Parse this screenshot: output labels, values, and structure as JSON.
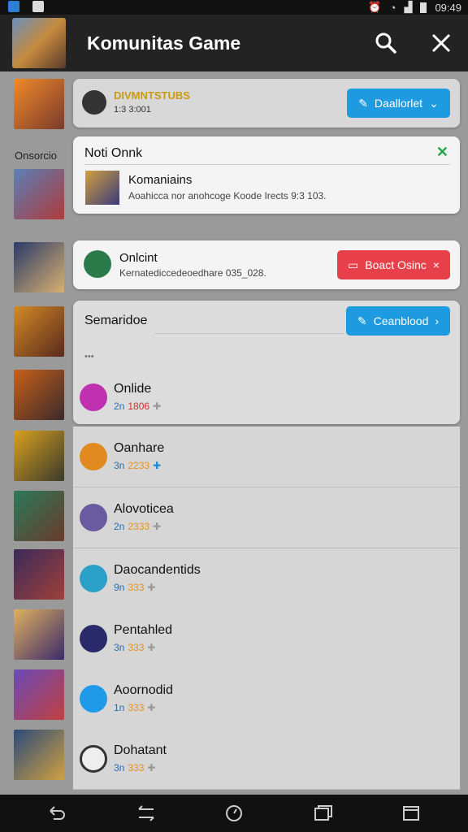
{
  "status_bar": {
    "time": "09:49"
  },
  "app_bar": {
    "title": "Komunitas Game"
  },
  "side_label": "Onsorcio",
  "top_card": {
    "title": "DIVMNTSTUBS",
    "subtitle": "1:3 3:001",
    "button_label": "Daallorlet"
  },
  "notif_card": {
    "header": "Noti Onnk",
    "item_title": "Komaniains",
    "item_text": "Aoahicca nor anohcoge Koode Irects 9:3 103."
  },
  "online_card": {
    "title": "Onlcint",
    "text": "Kernatediccedeoedhare 035_028.",
    "button_label": "Boact Osinc"
  },
  "section_card": {
    "title": "Semaridoe",
    "button_label": "Ceanblood",
    "dots": "•••"
  },
  "list_items": [
    {
      "name": "Onlide",
      "num": "2n",
      "code": "1806",
      "stars": ""
    },
    {
      "name": "Oanhare",
      "num": "3n",
      "code": "",
      "stars": "2233"
    },
    {
      "name": "Alovoticea",
      "num": "2n",
      "code": "",
      "stars": "2333"
    },
    {
      "name": "Daocandentids",
      "num": "9n",
      "code": "",
      "stars": "333"
    },
    {
      "name": "Pentahled",
      "num": "3n",
      "code": "",
      "stars": "333"
    },
    {
      "name": "Aoornodid",
      "num": "1n",
      "code": "",
      "stars": "333"
    },
    {
      "name": "Dohatant",
      "num": "3n",
      "code": "",
      "stars": "333"
    }
  ],
  "colors": {
    "accent_blue": "#1d9ae0",
    "accent_red": "#e8404a",
    "green_x": "#22a64a"
  }
}
